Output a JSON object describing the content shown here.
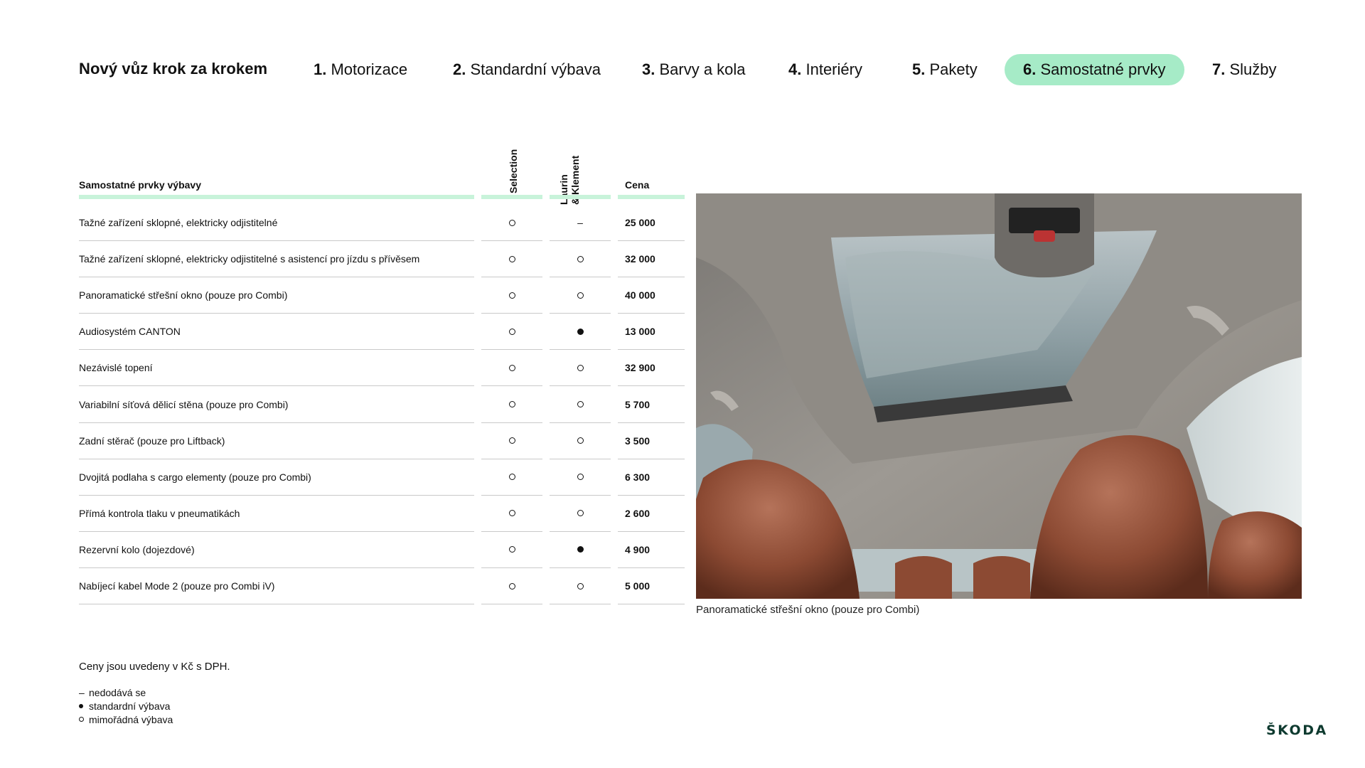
{
  "nav": {
    "title": "Nový vůz krok za krokem",
    "steps": [
      {
        "num": "1.",
        "label": "Motorizace"
      },
      {
        "num": "2.",
        "label": "Standardní výbava"
      },
      {
        "num": "3.",
        "label": "Barvy a kola"
      },
      {
        "num": "4.",
        "label": "Interiéry"
      },
      {
        "num": "5.",
        "label": "Pakety"
      },
      {
        "num": "6.",
        "label": "Samostatné prvky"
      },
      {
        "num": "7.",
        "label": "Služby"
      }
    ],
    "active_step": "6.",
    "active_color": "#a6ebc7"
  },
  "table": {
    "header_name": "Samostatné prvky výbavy",
    "header_col1": "Selection",
    "header_col2_line1": "Laurin",
    "header_col2_line2": "& Klement",
    "header_price": "Cena",
    "rows": [
      {
        "name": "Tažné zařízení sklopné, elektricky odjistitelné",
        "selection": "optional",
        "lk": "not-available",
        "price": "25 000"
      },
      {
        "name": "Tažné zařízení sklopné, elektricky odjistitelné s asistencí pro jízdu s přívěsem",
        "selection": "optional",
        "lk": "optional",
        "price": "32 000"
      },
      {
        "name": "Panoramatické střešní okno (pouze pro Combi)",
        "selection": "optional",
        "lk": "optional",
        "price": "40 000"
      },
      {
        "name": "Audiosystém CANTON",
        "selection": "optional",
        "lk": "standard",
        "price": "13 000"
      },
      {
        "name": "Nezávislé topení",
        "selection": "optional",
        "lk": "optional",
        "price": "32 900"
      },
      {
        "name": "Variabilní síťová dělicí stěna (pouze pro Combi)",
        "selection": "optional",
        "lk": "optional",
        "price": "5 700"
      },
      {
        "name": "Zadní stěrač (pouze pro Liftback)",
        "selection": "optional",
        "lk": "optional",
        "price": "3 500"
      },
      {
        "name": "Dvojitá podlaha s cargo elementy (pouze pro Combi)",
        "selection": "optional",
        "lk": "optional",
        "price": "6 300"
      },
      {
        "name": "Přímá kontrola tlaku v pneumatikách",
        "selection": "optional",
        "lk": "optional",
        "price": "2 600"
      },
      {
        "name": "Rezervní kolo (dojezdové)",
        "selection": "optional",
        "lk": "standard",
        "price": "4 900"
      },
      {
        "name": "Nabíjecí kabel Mode 2 (pouze pro Combi iV)",
        "selection": "optional",
        "lk": "optional",
        "price": "5 000"
      }
    ]
  },
  "photo": {
    "caption": "Panoramatické střešní okno (pouze pro Combi)"
  },
  "notes": {
    "prices": "Ceny jsou uvedeny v Kč s DPH.",
    "dash_symbol": "–",
    "legend_not_available": "nedodává se",
    "legend_standard": "standardní výbava",
    "legend_optional": "mimořádná výbava"
  },
  "logo": {
    "text": "ŠKODA",
    "color": "#0e3a2f"
  }
}
